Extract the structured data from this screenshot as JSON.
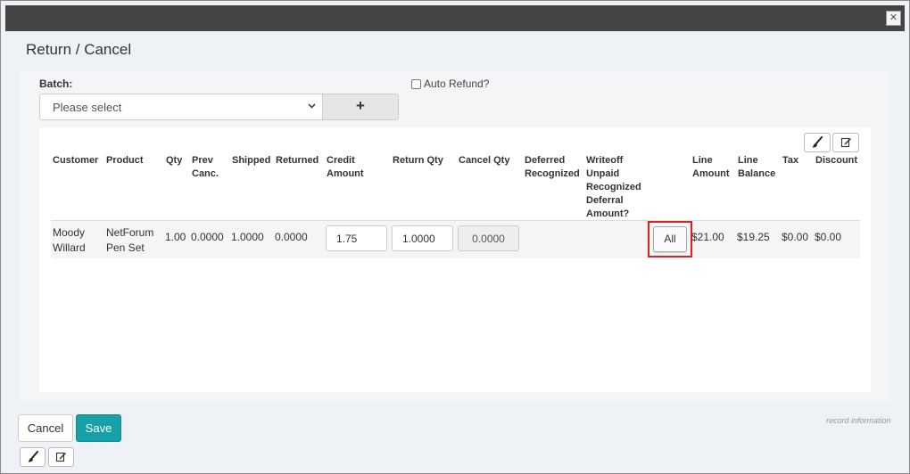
{
  "window": {
    "close_glyph": "✕"
  },
  "dialog": {
    "title": "Return / Cancel"
  },
  "batch": {
    "label": "Batch:",
    "selected": "Please select",
    "add_glyph": "+"
  },
  "auto_refund": {
    "label": "Auto Refund?",
    "checked": false
  },
  "grid": {
    "toolbar": {
      "brush_glyph": "🖌",
      "edit_glyph": "✎"
    },
    "columns": {
      "customer": "Customer",
      "product": "Product",
      "qty": "Qty",
      "prev_canc": "Prev Canc.",
      "shipped": "Shipped",
      "returned": "Returned",
      "credit_amount": "Credit Amount",
      "return_qty": "Return Qty",
      "cancel_qty": "Cancel Qty",
      "deferred_recognized": "Deferred Recognized",
      "writeoff": "Writeoff Unpaid Recognized Deferral Amount?",
      "line_amount": "Line Amount",
      "line_balance": "Line Balance",
      "tax": "Tax",
      "discount": "Discount"
    },
    "rows": [
      {
        "customer": "Moody Willard",
        "product": "NetForum Pen Set",
        "qty": "1.00",
        "prev_canc": "0.0000",
        "shipped": "1.0000",
        "returned": "0.0000",
        "credit_amount": "1.75",
        "return_qty": "1.0000",
        "cancel_qty": "0.0000",
        "all_label": "All",
        "line_amount": "$21.00",
        "line_balance": "$19.25",
        "tax": "$0.00",
        "discount": "$0.00"
      }
    ]
  },
  "footer": {
    "record_info": "record information",
    "cancel_label": "Cancel",
    "save_label": "Save"
  },
  "colors": {
    "accent": "#16a0a8",
    "highlight": "#e02020",
    "titlebar": "#444444"
  }
}
